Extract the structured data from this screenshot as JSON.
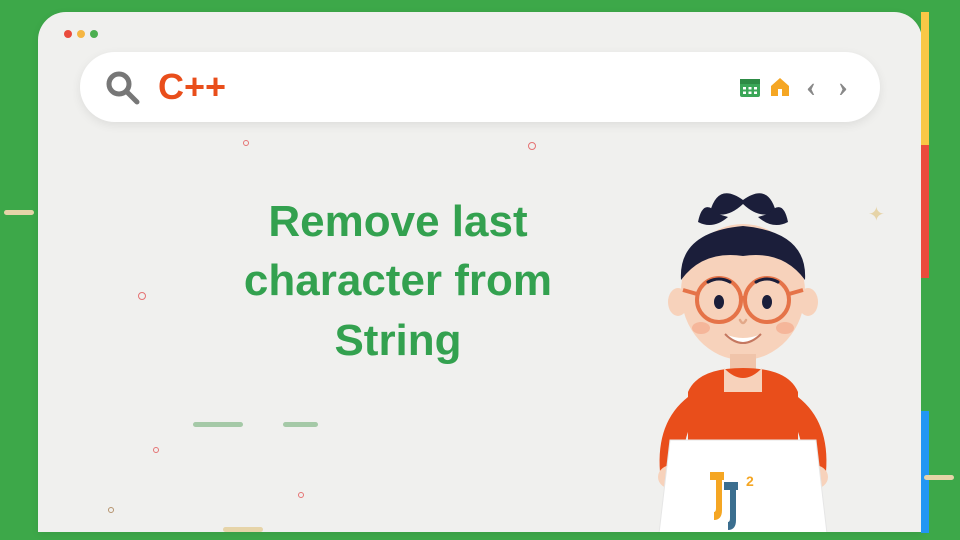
{
  "searchbar": {
    "query": "C++",
    "icons": {
      "calendar": "calendar-icon",
      "home": "home-icon",
      "back": "‹",
      "forward": "›"
    }
  },
  "title": "Remove last character from String",
  "logo": {
    "text": "J²"
  },
  "colors": {
    "frame": "#3da849",
    "accent_orange": "#e94e1b",
    "title_green": "#33a14f"
  }
}
